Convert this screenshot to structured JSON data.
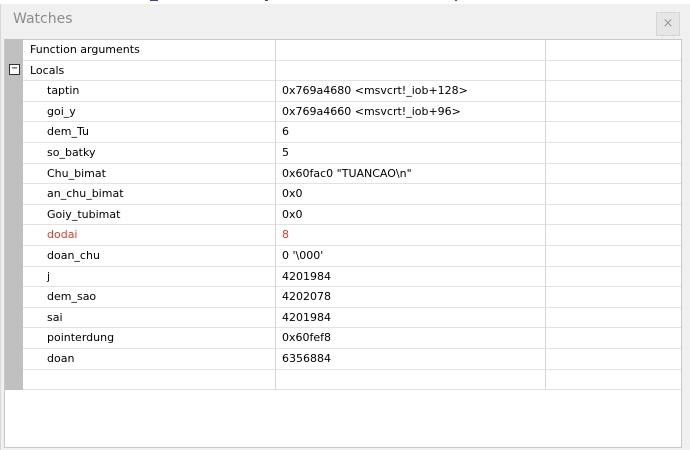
{
  "window": {
    "title": "Watches",
    "close_label": "×"
  },
  "colors": {
    "changed_value": "#e23a2a",
    "gutter": "#c0c0c0",
    "panel_bg": "#ffffff"
  },
  "rows": [
    {
      "name": "Function arguments",
      "value": "",
      "type": "",
      "level": 0,
      "toggle": ""
    },
    {
      "name": "Locals",
      "value": "",
      "type": "",
      "level": 0,
      "toggle": "−"
    },
    {
      "name": "taptin",
      "value": "0x769a4680 <msvcrt!_iob+128>",
      "type": "",
      "level": 1,
      "toggle": ""
    },
    {
      "name": "goi_y",
      "value": "0x769a4660 <msvcrt!_iob+96>",
      "type": "",
      "level": 1,
      "toggle": ""
    },
    {
      "name": "dem_Tu",
      "value": "6",
      "type": "",
      "level": 1,
      "toggle": ""
    },
    {
      "name": "so_batky",
      "value": "5",
      "type": "",
      "level": 1,
      "toggle": ""
    },
    {
      "name": "Chu_bimat",
      "value": "0x60fac0 \"TUANCAO\\n\"",
      "type": "",
      "level": 1,
      "toggle": ""
    },
    {
      "name": "an_chu_bimat",
      "value": "0x0",
      "type": "",
      "level": 1,
      "toggle": ""
    },
    {
      "name": "Goiy_tubimat",
      "value": "0x0",
      "type": "",
      "level": 1,
      "toggle": ""
    },
    {
      "name": "dodai",
      "value": "8",
      "type": "",
      "level": 1,
      "toggle": "",
      "changed": true
    },
    {
      "name": "doan_chu",
      "value": "0 '\\000'",
      "type": "",
      "level": 1,
      "toggle": ""
    },
    {
      "name": "j",
      "value": "4201984",
      "type": "",
      "level": 1,
      "toggle": ""
    },
    {
      "name": "dem_sao",
      "value": "4202078",
      "type": "",
      "level": 1,
      "toggle": ""
    },
    {
      "name": "sai",
      "value": "4201984",
      "type": "",
      "level": 1,
      "toggle": ""
    },
    {
      "name": "pointerdung",
      "value": "0x60fef8",
      "type": "",
      "level": 1,
      "toggle": ""
    },
    {
      "name": "doan",
      "value": "6356884",
      "type": "",
      "level": 1,
      "toggle": ""
    },
    {
      "name": "",
      "value": "",
      "type": "",
      "level": 0,
      "toggle": ""
    }
  ]
}
